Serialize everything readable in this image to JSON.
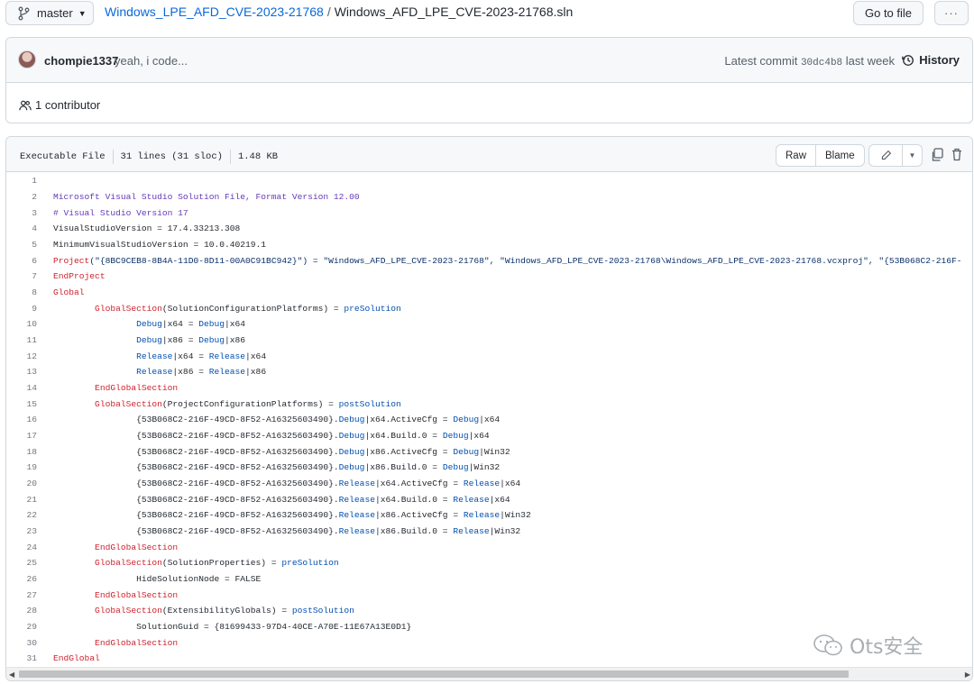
{
  "topbar": {
    "branch": "master",
    "repo": "Windows_LPE_AFD_CVE-2023-21768",
    "separator": "/",
    "filename": "Windows_AFD_LPE_CVE-2023-21768.sln",
    "goto_label": "Go to file",
    "more_label": "···"
  },
  "commit": {
    "author": "chompie1337",
    "message": "yeah, i code...",
    "latest_label": "Latest commit",
    "sha": "30dc4b8",
    "when": "last week",
    "history_label": "History"
  },
  "contributors": {
    "label": "1 contributor"
  },
  "file": {
    "type": "Executable File",
    "lines": "31 lines (31 sloc)",
    "size": "1.48 KB",
    "raw_label": "Raw",
    "blame_label": "Blame"
  },
  "code_lines": [
    [],
    [
      {
        "t": "Microsoft Visual Studio Solution File, Format Version 12.00",
        "c": "cm"
      }
    ],
    [
      {
        "t": "# Visual Studio Version 17",
        "c": "cm"
      }
    ],
    [
      {
        "t": "VisualStudioVersion = 17.4.33213.308",
        "c": ""
      }
    ],
    [
      {
        "t": "MinimumVisualStudioVersion = 10.0.40219.1",
        "c": ""
      }
    ],
    [
      {
        "t": "Project",
        "c": "kw"
      },
      {
        "t": "(\"{8BC9CEB8-8B4A-11D0-8D11-00A0C91BC942}\") = \"Windows_AFD_LPE_CVE-2023-21768\", \"Windows_AFD_LPE_CVE-2023-21768\\Windows_AFD_LPE_CVE-2023-21768.vcxproj\", \"{53B068C2-216F-",
        "c": "st"
      }
    ],
    [
      {
        "t": "EndProject",
        "c": "kw"
      }
    ],
    [
      {
        "t": "Global",
        "c": "kw"
      }
    ],
    [
      {
        "t": "\tGlobalSection",
        "c": "kw"
      },
      {
        "t": "(SolutionConfigurationPlatforms) = ",
        "c": ""
      },
      {
        "t": "preSolution",
        "c": "bl"
      }
    ],
    [
      {
        "t": "\t\tDebug",
        "c": "bl"
      },
      {
        "t": "|x64 = ",
        "c": ""
      },
      {
        "t": "Debug",
        "c": "bl"
      },
      {
        "t": "|x64",
        "c": ""
      }
    ],
    [
      {
        "t": "\t\tDebug",
        "c": "bl"
      },
      {
        "t": "|x86 = ",
        "c": ""
      },
      {
        "t": "Debug",
        "c": "bl"
      },
      {
        "t": "|x86",
        "c": ""
      }
    ],
    [
      {
        "t": "\t\tRelease",
        "c": "bl"
      },
      {
        "t": "|x64 = ",
        "c": ""
      },
      {
        "t": "Release",
        "c": "bl"
      },
      {
        "t": "|x64",
        "c": ""
      }
    ],
    [
      {
        "t": "\t\tRelease",
        "c": "bl"
      },
      {
        "t": "|x86 = ",
        "c": ""
      },
      {
        "t": "Release",
        "c": "bl"
      },
      {
        "t": "|x86",
        "c": ""
      }
    ],
    [
      {
        "t": "\tEndGlobalSection",
        "c": "kw"
      }
    ],
    [
      {
        "t": "\tGlobalSection",
        "c": "kw"
      },
      {
        "t": "(ProjectConfigurationPlatforms) = ",
        "c": ""
      },
      {
        "t": "postSolution",
        "c": "bl"
      }
    ],
    [
      {
        "t": "\t\t{53B068C2-216F-49CD-8F52-A16325603490}.",
        "c": ""
      },
      {
        "t": "Debug",
        "c": "bl"
      },
      {
        "t": "|x64.ActiveCfg = ",
        "c": ""
      },
      {
        "t": "Debug",
        "c": "bl"
      },
      {
        "t": "|x64",
        "c": ""
      }
    ],
    [
      {
        "t": "\t\t{53B068C2-216F-49CD-8F52-A16325603490}.",
        "c": ""
      },
      {
        "t": "Debug",
        "c": "bl"
      },
      {
        "t": "|x64.Build.0 = ",
        "c": ""
      },
      {
        "t": "Debug",
        "c": "bl"
      },
      {
        "t": "|x64",
        "c": ""
      }
    ],
    [
      {
        "t": "\t\t{53B068C2-216F-49CD-8F52-A16325603490}.",
        "c": ""
      },
      {
        "t": "Debug",
        "c": "bl"
      },
      {
        "t": "|x86.ActiveCfg = ",
        "c": ""
      },
      {
        "t": "Debug",
        "c": "bl"
      },
      {
        "t": "|Win32",
        "c": ""
      }
    ],
    [
      {
        "t": "\t\t{53B068C2-216F-49CD-8F52-A16325603490}.",
        "c": ""
      },
      {
        "t": "Debug",
        "c": "bl"
      },
      {
        "t": "|x86.Build.0 = ",
        "c": ""
      },
      {
        "t": "Debug",
        "c": "bl"
      },
      {
        "t": "|Win32",
        "c": ""
      }
    ],
    [
      {
        "t": "\t\t{53B068C2-216F-49CD-8F52-A16325603490}.",
        "c": ""
      },
      {
        "t": "Release",
        "c": "bl"
      },
      {
        "t": "|x64.ActiveCfg = ",
        "c": ""
      },
      {
        "t": "Release",
        "c": "bl"
      },
      {
        "t": "|x64",
        "c": ""
      }
    ],
    [
      {
        "t": "\t\t{53B068C2-216F-49CD-8F52-A16325603490}.",
        "c": ""
      },
      {
        "t": "Release",
        "c": "bl"
      },
      {
        "t": "|x64.Build.0 = ",
        "c": ""
      },
      {
        "t": "Release",
        "c": "bl"
      },
      {
        "t": "|x64",
        "c": ""
      }
    ],
    [
      {
        "t": "\t\t{53B068C2-216F-49CD-8F52-A16325603490}.",
        "c": ""
      },
      {
        "t": "Release",
        "c": "bl"
      },
      {
        "t": "|x86.ActiveCfg = ",
        "c": ""
      },
      {
        "t": "Release",
        "c": "bl"
      },
      {
        "t": "|Win32",
        "c": ""
      }
    ],
    [
      {
        "t": "\t\t{53B068C2-216F-49CD-8F52-A16325603490}.",
        "c": ""
      },
      {
        "t": "Release",
        "c": "bl"
      },
      {
        "t": "|x86.Build.0 = ",
        "c": ""
      },
      {
        "t": "Release",
        "c": "bl"
      },
      {
        "t": "|Win32",
        "c": ""
      }
    ],
    [
      {
        "t": "\tEndGlobalSection",
        "c": "kw"
      }
    ],
    [
      {
        "t": "\tGlobalSection",
        "c": "kw"
      },
      {
        "t": "(SolutionProperties) = ",
        "c": ""
      },
      {
        "t": "preSolution",
        "c": "bl"
      }
    ],
    [
      {
        "t": "\t\tHideSolutionNode = FALSE",
        "c": ""
      }
    ],
    [
      {
        "t": "\tEndGlobalSection",
        "c": "kw"
      }
    ],
    [
      {
        "t": "\tGlobalSection",
        "c": "kw"
      },
      {
        "t": "(ExtensibilityGlobals) = ",
        "c": ""
      },
      {
        "t": "postSolution",
        "c": "bl"
      }
    ],
    [
      {
        "t": "\t\tSolutionGuid = {81699433-97D4-40CE-A70E-11E67A13E0D1}",
        "c": ""
      }
    ],
    [
      {
        "t": "\tEndGlobalSection",
        "c": "kw"
      }
    ],
    [
      {
        "t": "EndGlobal",
        "c": "kw"
      }
    ]
  ],
  "watermark": {
    "text": "Ots安全"
  }
}
